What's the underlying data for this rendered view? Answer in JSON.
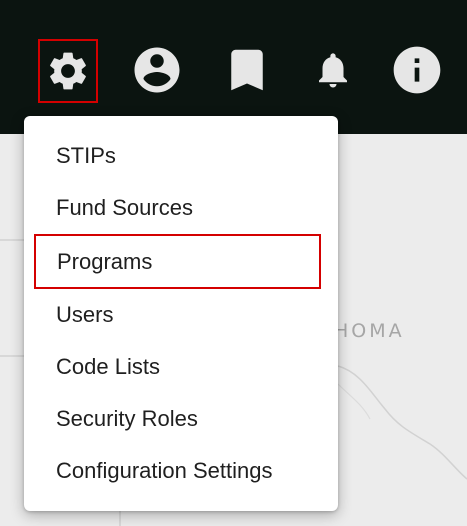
{
  "toolbar": {
    "icons": [
      {
        "name": "settings-icon",
        "highlighted": true
      },
      {
        "name": "account-icon",
        "highlighted": false
      },
      {
        "name": "bookmark-icon",
        "highlighted": false
      },
      {
        "name": "bell-icon",
        "highlighted": false
      },
      {
        "name": "info-icon",
        "highlighted": false
      }
    ],
    "background": "#0b1410",
    "icon_color": "#e6e6e6",
    "highlight_color": "#d40000"
  },
  "map": {
    "visible_label": "AHOMA"
  },
  "menu": {
    "items": [
      {
        "label": "STIPs"
      },
      {
        "label": "Fund Sources"
      },
      {
        "label": "Programs",
        "highlighted": true
      },
      {
        "label": "Users"
      },
      {
        "label": "Code Lists"
      },
      {
        "label": "Security Roles"
      },
      {
        "label": "Configuration Settings"
      }
    ]
  }
}
